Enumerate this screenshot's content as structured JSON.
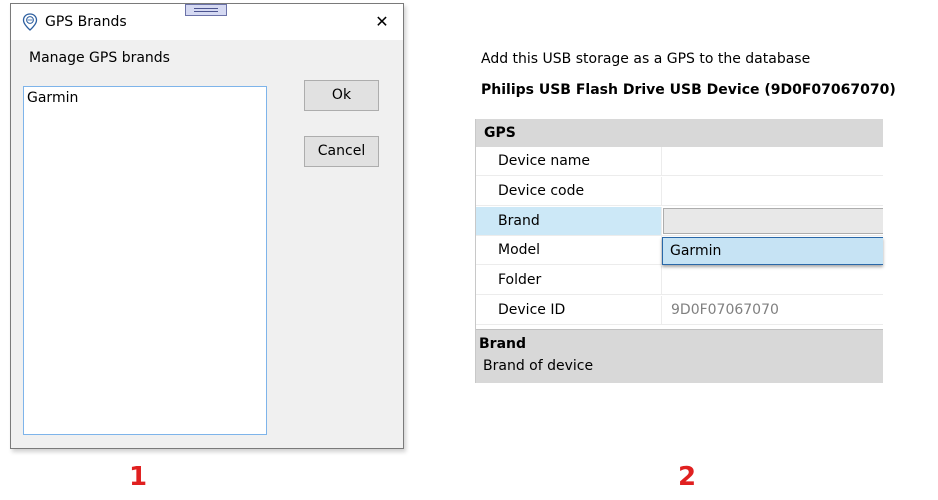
{
  "dialog": {
    "title": "GPS Brands",
    "close_label": "✕",
    "subtitle": "Manage GPS brands",
    "brands": [
      "Garmin"
    ],
    "ok_label": "Ok",
    "cancel_label": "Cancel"
  },
  "property_panel": {
    "intro": "Add this USB storage as a GPS to the database",
    "device_title": "Philips USB Flash Drive USB Device (9D0F07067070)",
    "category": "GPS",
    "rows": [
      {
        "label": "Device name",
        "value": ""
      },
      {
        "label": "Device code",
        "value": ""
      },
      {
        "label": "Brand",
        "value": ""
      },
      {
        "label": "Model",
        "value": ""
      },
      {
        "label": "Folder",
        "value": ""
      },
      {
        "label": "Device ID",
        "value": "9D0F07067070"
      }
    ],
    "selected_row": "Brand",
    "dropdown_options": [
      "Garmin"
    ],
    "help_title": "Brand",
    "help_description": "Brand of device"
  },
  "panel_numbers": [
    "1",
    "2"
  ],
  "colors": {
    "accent_red": "#e02020",
    "selection_blue": "#cce8f7",
    "list_border": "#7eb4ea"
  },
  "icons": {
    "app": "gps-pin-icon",
    "close": "close-icon"
  }
}
